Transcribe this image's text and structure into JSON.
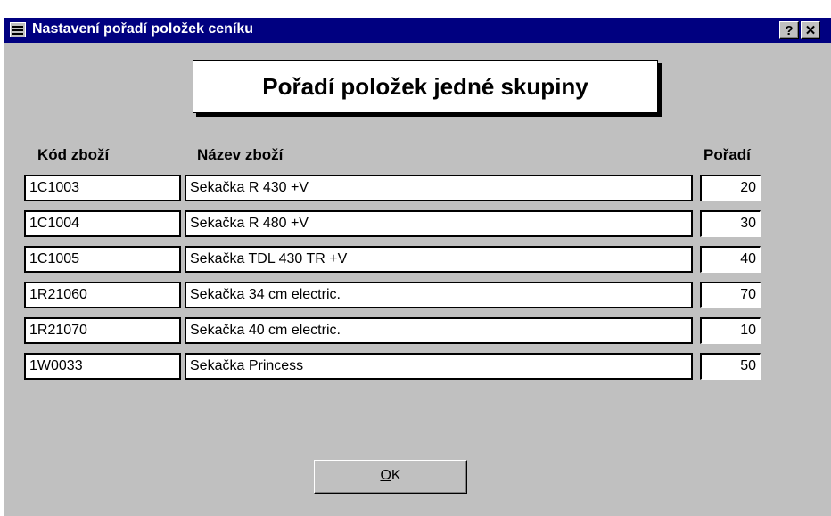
{
  "window": {
    "title": "Nastavení pořadí položek ceníku",
    "help_button": "?",
    "close_button": "✕"
  },
  "header": {
    "title": "Pořadí položek jedné skupiny"
  },
  "columns": {
    "code": "Kód zboží",
    "name": "Název zboží",
    "order": "Pořadí"
  },
  "rows": [
    {
      "code": "1C1003",
      "name": "Sekačka R 430 +V",
      "order": "20"
    },
    {
      "code": "1C1004",
      "name": "Sekačka R 480 +V",
      "order": "30"
    },
    {
      "code": "1C1005",
      "name": "Sekačka TDL 430 TR +V",
      "order": "40"
    },
    {
      "code": "1R21060",
      "name": "Sekačka 34 cm electric.",
      "order": "70"
    },
    {
      "code": "1R21070",
      "name": "Sekačka 40 cm electric.",
      "order": "10"
    },
    {
      "code": "1W0033",
      "name": "Sekačka Princess",
      "order": "50"
    }
  ],
  "ok_button": {
    "mnemonic": "O",
    "rest": "K"
  }
}
